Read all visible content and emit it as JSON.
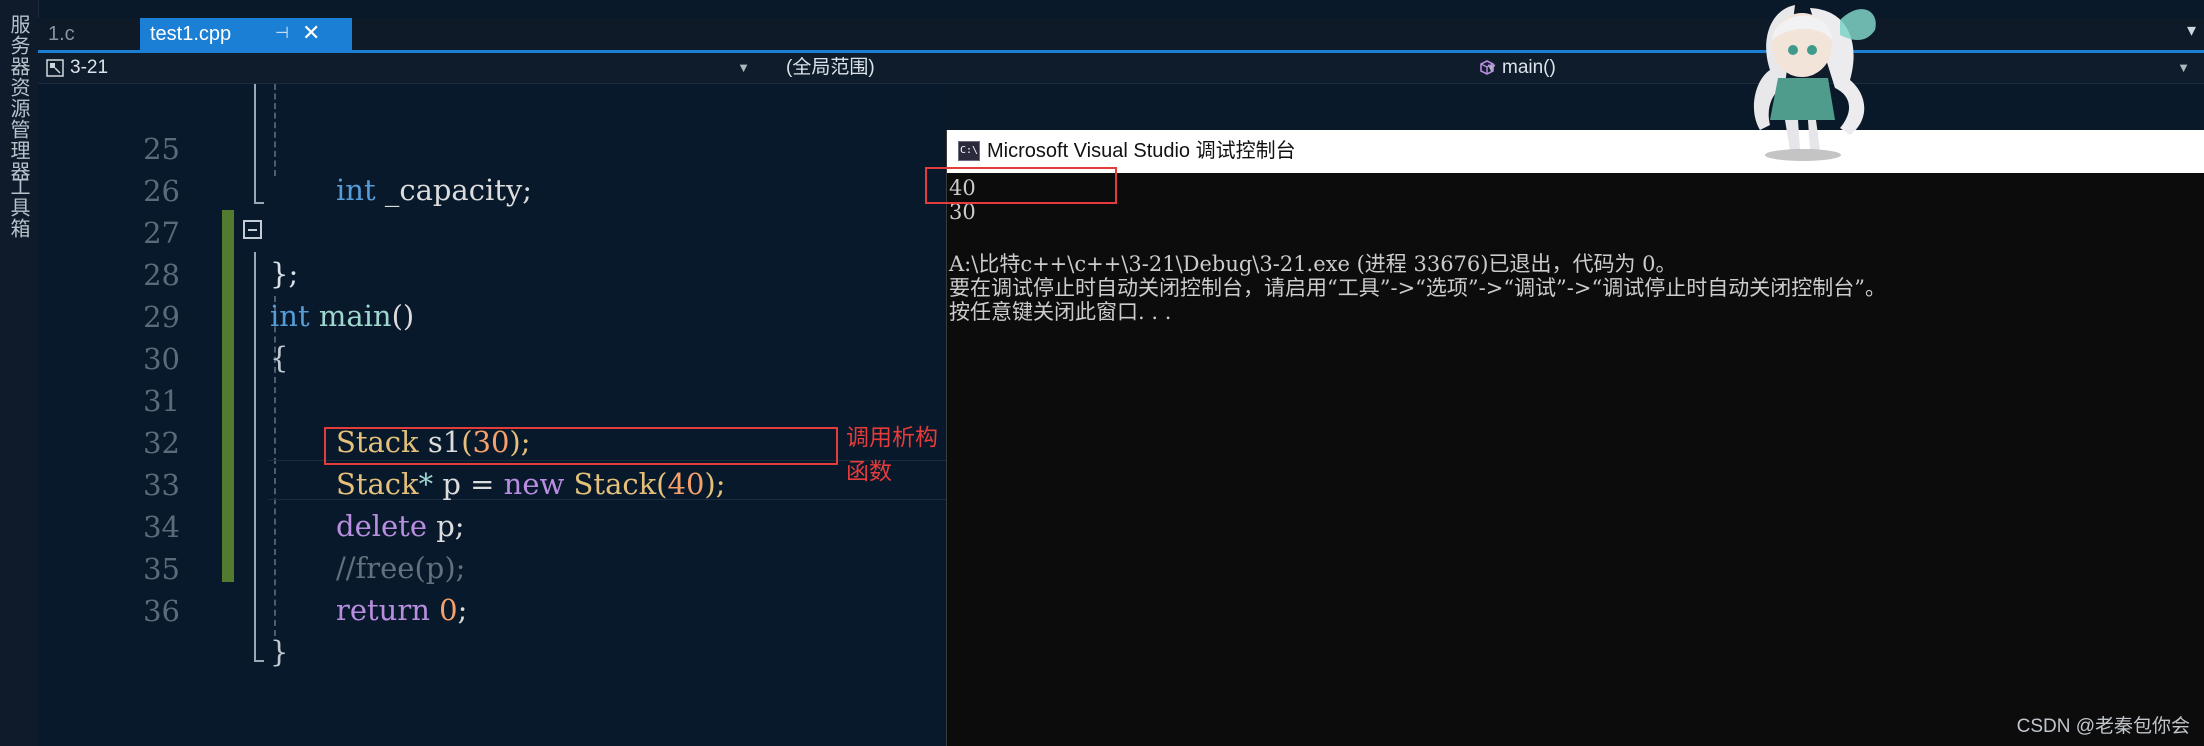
{
  "side_panel": {
    "items": [
      "服务器资源管理器",
      "工具箱"
    ]
  },
  "tabs": [
    {
      "label": "1.c",
      "active": false
    },
    {
      "label": "test1.cpp",
      "active": true
    }
  ],
  "tab_pin_glyph": "⊣",
  "tab_close_glyph": "✕",
  "navbar": {
    "project": "3-21",
    "scope": "(全局范围)",
    "function": "main()"
  },
  "code_lines": [
    {
      "num": "25",
      "text": "int _capacity;"
    },
    {
      "num": "26",
      "text": ""
    },
    {
      "num": "27",
      "text": "};"
    },
    {
      "num": "28",
      "text": "int main()"
    },
    {
      "num": "29",
      "text": "{"
    },
    {
      "num": "30",
      "text": ""
    },
    {
      "num": "31",
      "text": "Stack s1(30);"
    },
    {
      "num": "32",
      "text": "Stack* p = new Stack(40);"
    },
    {
      "num": "33",
      "text": "delete p;"
    },
    {
      "num": "34",
      "text": "//free(p);"
    },
    {
      "num": "35",
      "text": "return 0;"
    },
    {
      "num": "36",
      "text": "}"
    }
  ],
  "tokens": {
    "l25": [
      "int",
      " _capacity;"
    ],
    "l27": "};",
    "l28": [
      "int",
      " main",
      "()"
    ],
    "l29": "{",
    "l31": [
      "Stack",
      " s1",
      "(",
      "30",
      ");"
    ],
    "l32": [
      "Stack",
      "*",
      " p = ",
      "new",
      " Stack",
      "(",
      "40",
      ");"
    ],
    "l33": [
      "delete",
      " p;"
    ],
    "l34": "//free(p);",
    "l35": [
      "return",
      " ",
      "0",
      ";"
    ],
    "l36": "}"
  },
  "annotation": "调用析构函数",
  "console": {
    "title": "Microsoft Visual Studio 调试控制台",
    "icon_text": "C:\\",
    "lines": [
      "40",
      "30",
      "",
      "A:\\比特c++\\c++\\3-21\\Debug\\3-21.exe (进程 33676)已退出，代码为 0。",
      "要在调试停止时自动关闭控制台，请启用“工具”->“选项”->“调试”->“调试停止时自动关闭控制台”。",
      "按任意键关闭此窗口. . ."
    ]
  },
  "watermark": "CSDN @老秦包你会",
  "colors": {
    "editor_bg": "#07192b",
    "accent_tab": "#1c7fd6",
    "annotation_red": "#e43b3b",
    "keyword": "#b98ee0",
    "type": "#e5c07b",
    "number": "#f7a06a",
    "change_bar": "#537b30"
  }
}
